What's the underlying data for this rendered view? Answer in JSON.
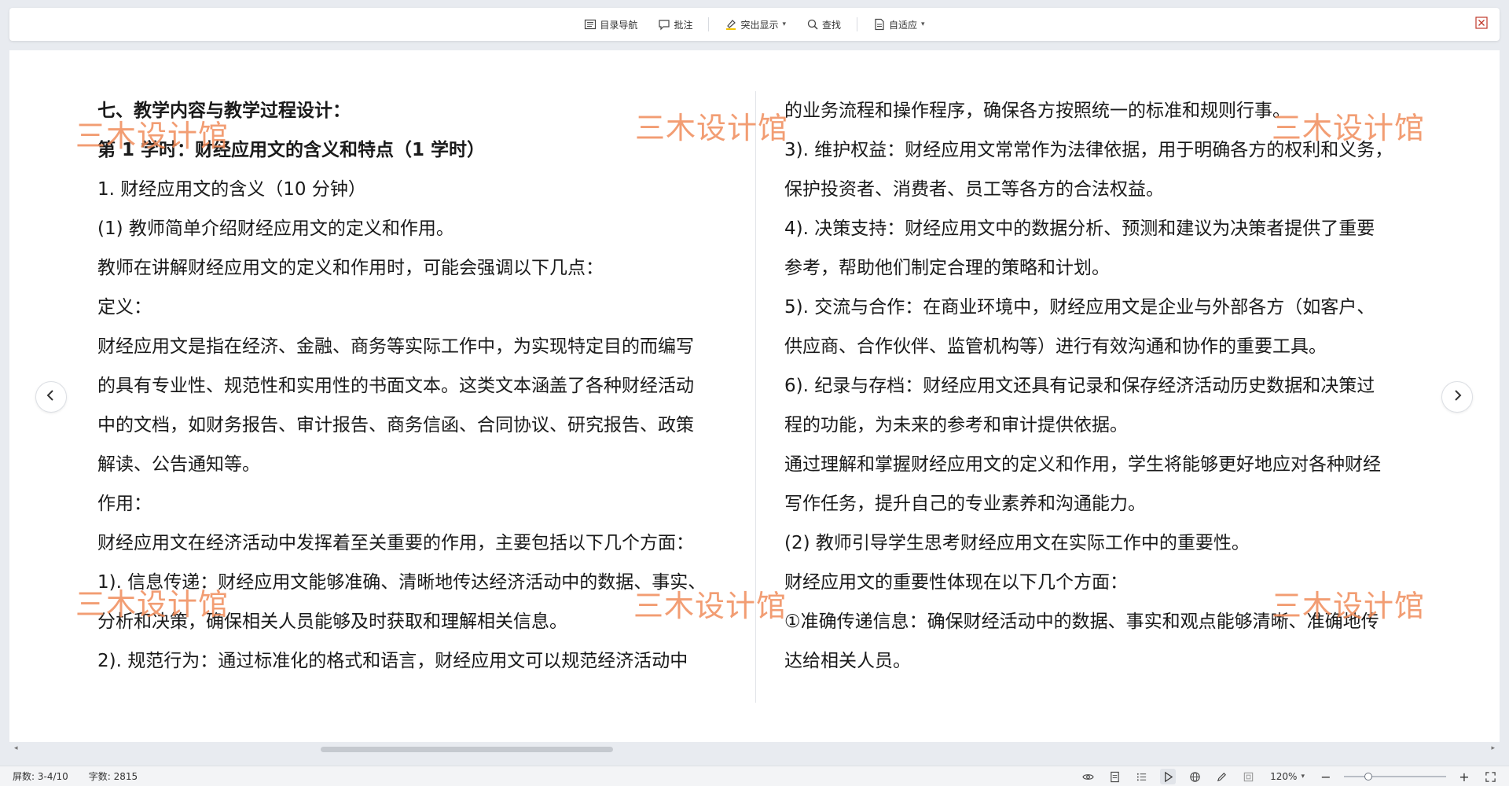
{
  "toolbar": {
    "toc_label": "目录导航",
    "comment_label": "批注",
    "highlight_label": "突出显示",
    "find_label": "查找",
    "fit_label": "自适应"
  },
  "watermark_text": "三木设计馆",
  "document": {
    "left_lines": [
      {
        "text": "七、教学内容与教学过程设计：",
        "bold": true
      },
      {
        "text": "第 1 学时：财经应用文的含义和特点（1 学时）",
        "bold": true
      },
      {
        "text": "1. 财经应用文的含义（10 分钟）",
        "bold": false
      },
      {
        "text": "(1) 教师简单介绍财经应用文的定义和作用。",
        "bold": false
      },
      {
        "text": "教师在讲解财经应用文的定义和作用时，可能会强调以下几点：",
        "bold": false
      },
      {
        "text": "定义：",
        "bold": false
      },
      {
        "text": "财经应用文是指在经济、金融、商务等实际工作中，为实现特定目的而编写",
        "bold": false
      },
      {
        "text": "的具有专业性、规范性和实用性的书面文本。这类文本涵盖了各种财经活动",
        "bold": false
      },
      {
        "text": "中的文档，如财务报告、审计报告、商务信函、合同协议、研究报告、政策",
        "bold": false
      },
      {
        "text": "解读、公告通知等。",
        "bold": false
      },
      {
        "text": "作用：",
        "bold": false
      },
      {
        "text": "财经应用文在经济活动中发挥着至关重要的作用，主要包括以下几个方面：",
        "bold": false
      },
      {
        "text": "1). 信息传递：财经应用文能够准确、清晰地传达经济活动中的数据、事实、",
        "bold": false
      },
      {
        "text": "分析和决策，确保相关人员能够及时获取和理解相关信息。",
        "bold": false
      },
      {
        "text": "2). 规范行为：通过标准化的格式和语言，财经应用文可以规范经济活动中",
        "bold": false
      }
    ],
    "right_lines": [
      {
        "text": "的业务流程和操作程序，确保各方按照统一的标准和规则行事。",
        "bold": false
      },
      {
        "text": "3). 维护权益：财经应用文常常作为法律依据，用于明确各方的权利和义务，",
        "bold": false
      },
      {
        "text": "保护投资者、消费者、员工等各方的合法权益。",
        "bold": false
      },
      {
        "text": "4). 决策支持：财经应用文中的数据分析、预测和建议为决策者提供了重要",
        "bold": false
      },
      {
        "text": "参考，帮助他们制定合理的策略和计划。",
        "bold": false
      },
      {
        "text": "5). 交流与合作：在商业环境中，财经应用文是企业与外部各方（如客户、",
        "bold": false
      },
      {
        "text": "供应商、合作伙伴、监管机构等）进行有效沟通和协作的重要工具。",
        "bold": false
      },
      {
        "text": "6). 纪录与存档：财经应用文还具有记录和保存经济活动历史数据和决策过",
        "bold": false
      },
      {
        "text": "程的功能，为未来的参考和审计提供依据。",
        "bold": false
      },
      {
        "text": "通过理解和掌握财经应用文的定义和作用，学生将能够更好地应对各种财经",
        "bold": false
      },
      {
        "text": "写作任务，提升自己的专业素养和沟通能力。",
        "bold": false
      },
      {
        "text": "(2) 教师引导学生思考财经应用文在实际工作中的重要性。",
        "bold": false
      },
      {
        "text": "财经应用文的重要性体现在以下几个方面：",
        "bold": false
      },
      {
        "text": "①准确传递信息：确保财经活动中的数据、事实和观点能够清晰、准确地传",
        "bold": false
      },
      {
        "text": "达给相关人员。",
        "bold": false
      }
    ]
  },
  "status": {
    "page_info": "屏数: 3-4/10",
    "word_count": "字数: 2815",
    "zoom": "120%",
    "zoom_fraction": 0.22
  },
  "colors": {
    "watermark": "#f08c5a",
    "background": "#e8ebf0"
  },
  "icons": {
    "toc": "list-icon",
    "comment": "comment-icon",
    "highlight": "highlighter-icon",
    "find": "search-icon",
    "fit": "document-icon",
    "close": "close-icon",
    "prev": "chevron-left-icon",
    "next": "chevron-right-icon"
  }
}
